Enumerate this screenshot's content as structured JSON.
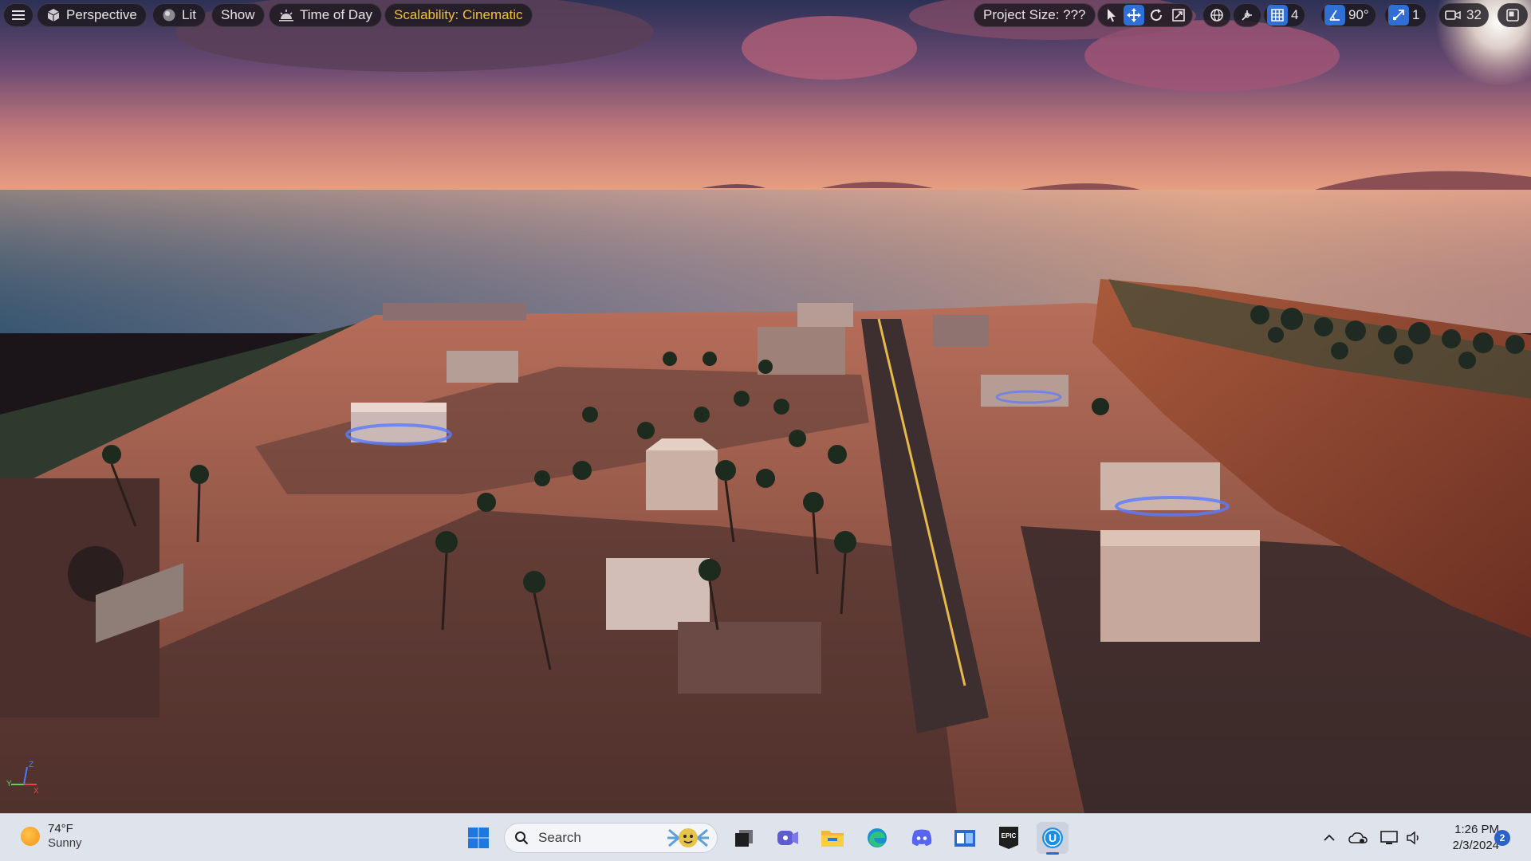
{
  "viewport": {
    "menu_icon": "hamburger-icon",
    "view_mode_label": "Perspective",
    "lighting_label": "Lit",
    "show_label": "Show",
    "time_of_day_label": "Time of Day",
    "scalability_label": "Scalability: Cinematic",
    "project_size_label": "Project Size: ???",
    "transform_tools": [
      "select-icon",
      "translate-icon",
      "rotate-icon",
      "scale-icon"
    ],
    "grid_snap_value": "4",
    "rotation_snap_value": "90°",
    "scale_snap_value": "1",
    "camera_speed_value": "32",
    "accent_color": "#2f6fd6",
    "scalability_color": "#f2c12e",
    "axis_labels": {
      "x": "X",
      "y": "Y",
      "z": "Z"
    }
  },
  "taskbar": {
    "weather_temp": "74°F",
    "weather_condition": "Sunny",
    "search_placeholder": "Search",
    "pinned_apps": [
      "start-icon",
      "task-view-icon",
      "teams-icon",
      "file-explorer-icon",
      "edge-icon",
      "discord-icon",
      "store-icon",
      "epic-games-icon",
      "unreal-engine-icon"
    ],
    "epic_label": "EPIC",
    "ue_label": "U",
    "tray_icons": [
      "chevron-up-icon",
      "onedrive-icon",
      "display-icon",
      "volume-icon"
    ],
    "time": "1:26 PM",
    "date": "2/3/2024",
    "notification_count": "2"
  }
}
